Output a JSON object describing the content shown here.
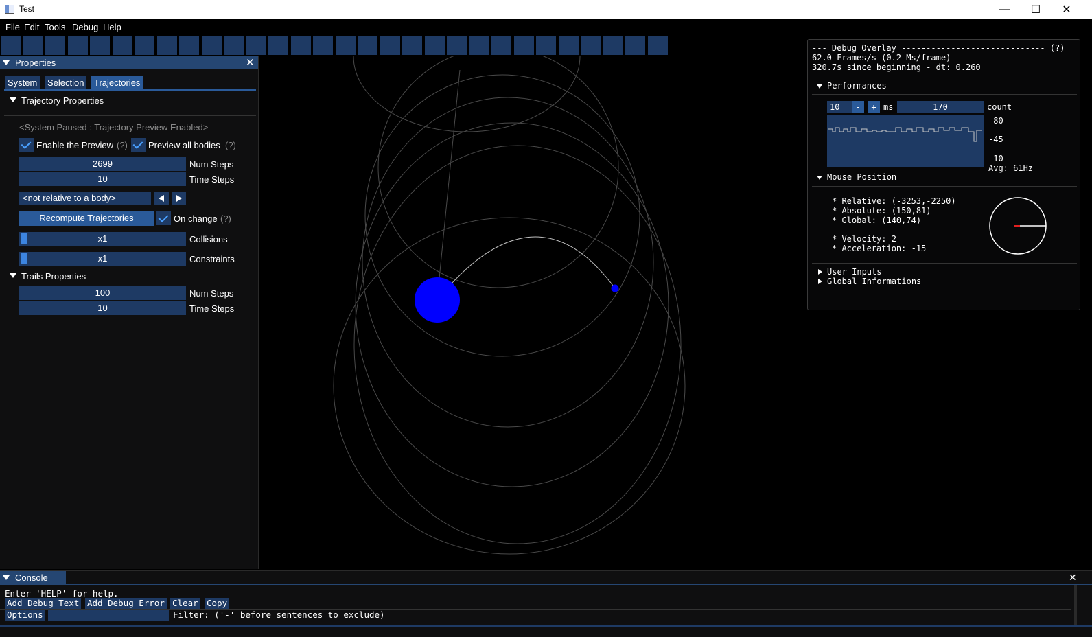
{
  "window": {
    "title": "Test"
  },
  "menu": [
    "File",
    "Edit",
    "Tools",
    "Debug",
    "Help"
  ],
  "properties": {
    "title": "Properties",
    "tabs": [
      "System",
      "Selection",
      "Trajectories"
    ],
    "active_tab": "Trajectories",
    "trajectory_section": "Trajectory Properties",
    "paused_note": "<System Paused : Trajectory Preview Enabled>",
    "enable_preview": {
      "label": "Enable the Preview",
      "checked": true,
      "help": "(?)"
    },
    "preview_all": {
      "label": "Preview all bodies",
      "checked": true,
      "help": "(?)"
    },
    "num_steps": {
      "value": "2699",
      "label": "Num Steps"
    },
    "time_steps": {
      "value": "10",
      "label": "Time Steps"
    },
    "relative_combo": "<not relative to a body>",
    "recompute_button": "Recompute Trajectories",
    "on_change": {
      "label": "On change",
      "checked": true,
      "help": "(?)"
    },
    "collisions": {
      "value": "x1",
      "label": "Collisions"
    },
    "constraints": {
      "value": "x1",
      "label": "Constraints"
    },
    "trails_section": "Trails Properties",
    "trail_num_steps": {
      "value": "100",
      "label": "Num Steps"
    },
    "trail_time_steps": {
      "value": "10",
      "label": "Time Steps"
    }
  },
  "debug_overlay": {
    "header": "--- Debug Overlay ----------------------------- (?)",
    "fps_line": "62.0 Frames/s (0.2 Ms/frame)",
    "time_line": "320.7s since beginning - dt: 0.260",
    "performances_label": "Performances",
    "perf_min": "10",
    "minus": "-",
    "plus": "+",
    "ms_label": "ms",
    "count_value": "170",
    "count_label": "count",
    "scale": [
      "-80",
      "-45",
      "-10"
    ],
    "avg": "Avg: 61Hz",
    "mouse_label": "Mouse Position",
    "relative": "* Relative: (-3253,-2250)",
    "absolute": "* Absolute: (150,81)",
    "global": "* Global: (140,74)",
    "velocity": "* Velocity: 2",
    "acceleration": "* Acceleration: -15",
    "user_inputs": "User Inputs",
    "global_info": "Global Informations",
    "footer": "-----------------------------------------------------"
  },
  "console": {
    "title": "Console",
    "help_line": "Enter 'HELP' for help.",
    "buttons": [
      "Add Debug Text",
      "Add Debug Error",
      "Clear",
      "Copy"
    ],
    "options": "Options",
    "filter_label": "Filter: ('-' before sentences to exclude)"
  },
  "colors": {
    "accent": "#2a5a99",
    "frame": "#1e3a64",
    "header": "#254672",
    "body": "#0000ff",
    "orbit": "#7f7f7f"
  }
}
